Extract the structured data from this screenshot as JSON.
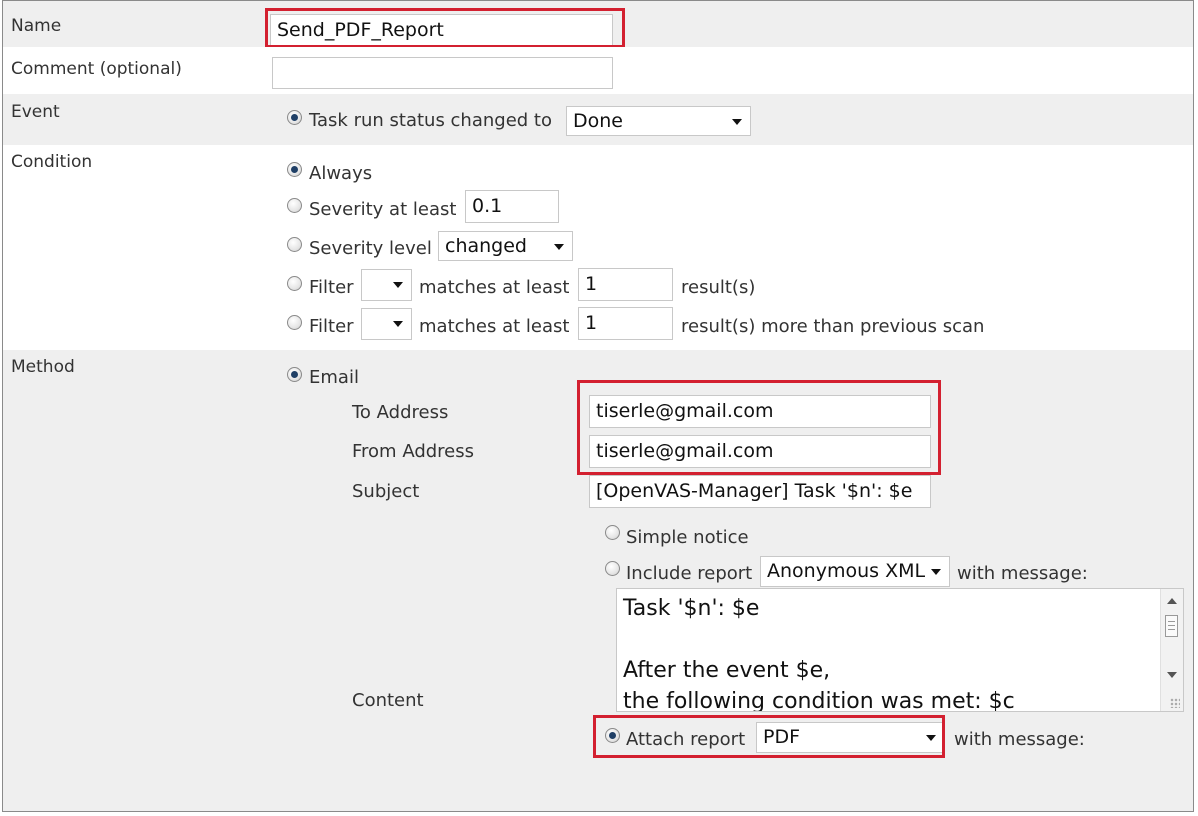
{
  "form": {
    "name": {
      "label": "Name",
      "value": "Send_PDF_Report"
    },
    "comment": {
      "label": "Comment (optional)",
      "value": ""
    },
    "event": {
      "label": "Event",
      "option_label": "Task run status changed to",
      "status_value": "Done"
    },
    "condition": {
      "label": "Condition",
      "always": "Always",
      "severity_at_least": {
        "label": "Severity at least",
        "value": "0.1"
      },
      "severity_level": {
        "label": "Severity level",
        "value": "changed"
      },
      "filter1": {
        "label": "Filter",
        "select_value": "",
        "matches": "matches at least",
        "count": "1",
        "suffix": "result(s)"
      },
      "filter2": {
        "label": "Filter",
        "select_value": "",
        "matches": "matches at least",
        "count": "1",
        "suffix": "result(s) more than previous scan"
      }
    },
    "method": {
      "label": "Method",
      "email": "Email",
      "to_address": {
        "label": "To Address",
        "value": "tiserle@gmail.com"
      },
      "from_address": {
        "label": "From Address",
        "value": "tiserle@gmail.com"
      },
      "subject": {
        "label": "Subject",
        "value": "[OpenVAS-Manager] Task '$n': $e"
      },
      "content": {
        "label": "Content",
        "simple_notice": "Simple notice",
        "include_report": {
          "label": "Include report",
          "format": "Anonymous XML",
          "suffix": "with message:"
        },
        "message_lines": [
          "Task '$n': $e",
          "",
          "After the event $e,",
          "the following condition was met: $c"
        ],
        "attach_report": {
          "label": "Attach report",
          "format": "PDF",
          "suffix": "with message:"
        }
      }
    }
  },
  "colors": {
    "highlight": "#d32030",
    "row_grey": "#efefef",
    "radio_dot": "#1f3f66"
  }
}
